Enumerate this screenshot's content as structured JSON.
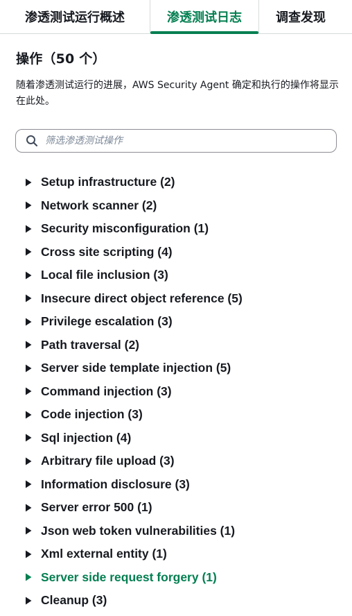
{
  "tabs": [
    {
      "label": "渗透测试运行概述",
      "active": false
    },
    {
      "label": "渗透测试日志",
      "active": true
    },
    {
      "label": "调查发现",
      "active": false
    }
  ],
  "colors": {
    "accent": "#037f51",
    "text": "#16191f",
    "border": "#d5dbdb",
    "placeholder": "#7d8998"
  },
  "section": {
    "title": "操作（50 个）",
    "description": "随着渗透测试运行的进展，AWS Security Agent 确定和执行的操作将显示在此处。"
  },
  "search": {
    "icon": "search-icon",
    "placeholder": "筛选渗透测试操作",
    "value": ""
  },
  "operations": [
    {
      "label": "Setup infrastructure (2)",
      "active": false
    },
    {
      "label": "Network scanner (2)",
      "active": false
    },
    {
      "label": "Security misconfiguration (1)",
      "active": false
    },
    {
      "label": "Cross site scripting (4)",
      "active": false
    },
    {
      "label": "Local file inclusion (3)",
      "active": false
    },
    {
      "label": "Insecure direct object reference (5)",
      "active": false
    },
    {
      "label": "Privilege escalation (3)",
      "active": false
    },
    {
      "label": "Path traversal (2)",
      "active": false
    },
    {
      "label": "Server side template injection (5)",
      "active": false
    },
    {
      "label": "Command injection (3)",
      "active": false
    },
    {
      "label": "Code injection (3)",
      "active": false
    },
    {
      "label": "Sql injection (4)",
      "active": false
    },
    {
      "label": "Arbitrary file upload (3)",
      "active": false
    },
    {
      "label": "Information disclosure (3)",
      "active": false
    },
    {
      "label": "Server error 500 (1)",
      "active": false
    },
    {
      "label": "Json web token vulnerabilities (1)",
      "active": false
    },
    {
      "label": "Xml external entity (1)",
      "active": false
    },
    {
      "label": "Server side request forgery (1)",
      "active": true
    },
    {
      "label": "Cleanup (3)",
      "active": false
    }
  ]
}
